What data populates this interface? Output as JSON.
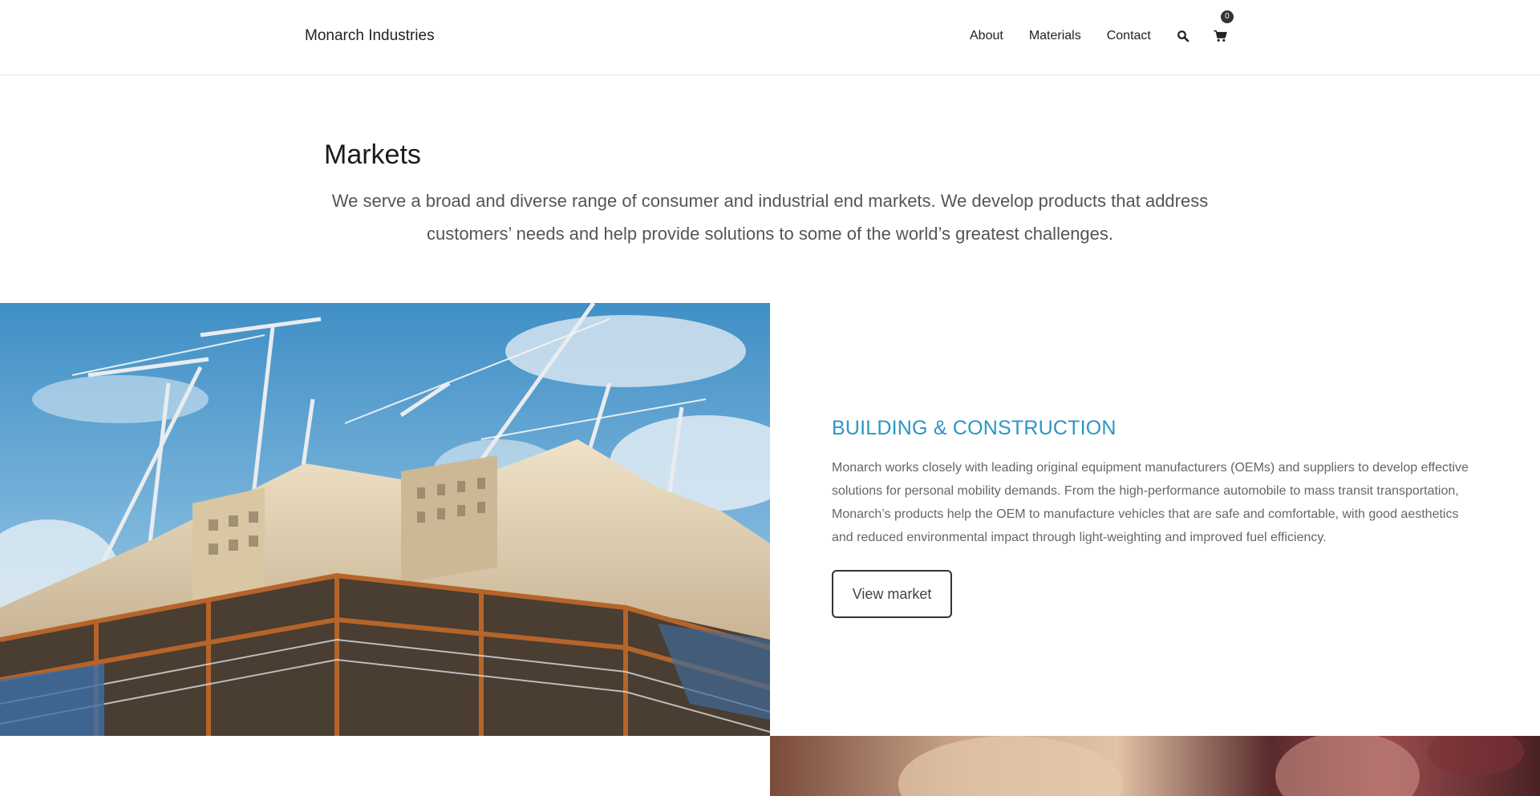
{
  "header": {
    "brand": "Monarch Industries",
    "nav": [
      {
        "label": "About"
      },
      {
        "label": "Materials"
      },
      {
        "label": "Contact"
      }
    ],
    "search_icon": "search-icon",
    "cart_icon": "shopping-cart-icon",
    "cart_count": "0"
  },
  "intro": {
    "title": "Markets",
    "text": "We serve a broad and diverse range of consumer and industrial end markets. We develop products that address customers’ needs and help provide solutions to some of the world’s greatest challenges."
  },
  "market": {
    "image": "construction-cranes-photo",
    "title": "BUILDING & CONSTRUCTION",
    "description": "Monarch works closely with leading original equipment manufacturers (OEMs) and suppliers to develop effective solutions for personal mobility demands. From the high-performance automobile to mass transit transportation, Monarch’s products help the OEM to manufacture vehicles that are safe and comfortable, with good aesthetics and reduced environmental impact through light-weighting and improved fuel efficiency.",
    "button": "View market",
    "accent_color": "#2b96c6"
  },
  "next_market": {
    "image": "next-market-photo"
  }
}
